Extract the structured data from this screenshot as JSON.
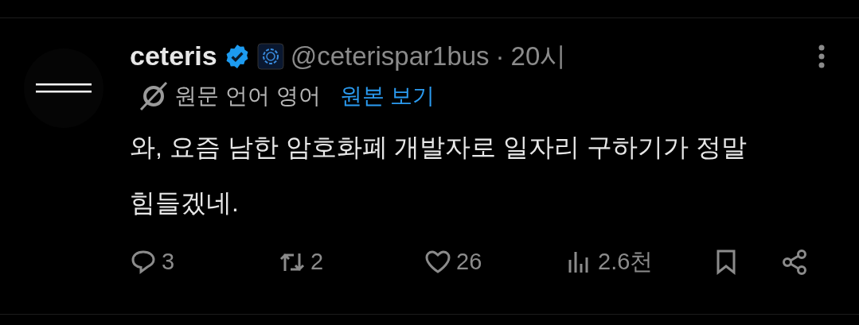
{
  "author": {
    "name": "ceteris",
    "verified": true,
    "handle": "@ceterispar1bus",
    "separator": "·",
    "time": "20시"
  },
  "translation": {
    "label": "원문 언어 영어",
    "link": "원본 보기"
  },
  "body": "와, 요즘 남한 암호화폐 개발자로 일자리 구하기가 정말 힘들겠네.",
  "actions": [
    {
      "kind": "reply",
      "count": "3"
    },
    {
      "kind": "repost",
      "count": "2"
    },
    {
      "kind": "like",
      "count": "26"
    },
    {
      "kind": "views",
      "count": "2.6천"
    },
    {
      "kind": "bookmark"
    },
    {
      "kind": "share"
    }
  ]
}
